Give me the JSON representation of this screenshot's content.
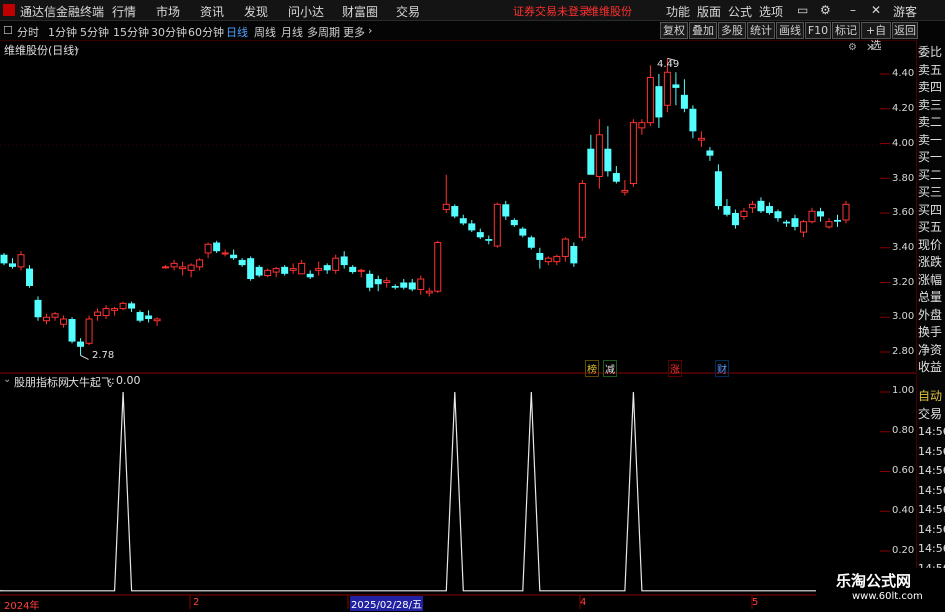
{
  "menubar": {
    "app_title": "通达信金融终端",
    "items": [
      "行情",
      "市场",
      "资讯",
      "发现",
      "问小达",
      "财富圈",
      "交易"
    ],
    "notice": "证券交易未登录",
    "stock": "维维股份",
    "right_items": [
      "功能",
      "版面",
      "公式",
      "选项"
    ],
    "guest": "游客"
  },
  "toolbar": {
    "periods": [
      "分时",
      "1分钟",
      "5分钟",
      "15分钟",
      "30分钟",
      "60分钟",
      "日线",
      "周线",
      "月线",
      "多周期",
      "更多"
    ],
    "selected": "日线",
    "buttons": [
      "复权",
      "叠加",
      "多股",
      "统计",
      "画线",
      "F10",
      "标记",
      "+自选",
      "返回"
    ]
  },
  "main_chart": {
    "title": "维维股份(日线)",
    "high_label": "4.49",
    "low_label": "2.78",
    "y_ticks": [
      "4.40",
      "4.20",
      "4.00",
      "3.80",
      "3.60",
      "3.40",
      "3.20",
      "3.00",
      "2.80"
    ],
    "event_tags": [
      {
        "text": "榜",
        "color": "#d8c030"
      },
      {
        "text": "减",
        "color": "#e0e0e0"
      },
      {
        "text": "涨",
        "color": "#ff3030"
      },
      {
        "text": "财",
        "color": "#5a9bff"
      }
    ]
  },
  "chart_data": {
    "type": "candlestick",
    "series": [
      {
        "name": "维维股份",
        "ohlc": [
          [
            3.36,
            3.37,
            3.3,
            3.31
          ],
          [
            3.31,
            3.34,
            3.28,
            3.29
          ],
          [
            3.29,
            3.38,
            3.27,
            3.36
          ],
          [
            3.28,
            3.3,
            3.17,
            3.18
          ],
          [
            3.1,
            3.12,
            2.98,
            3.0
          ],
          [
            2.98,
            3.02,
            2.96,
            3.0
          ],
          [
            3.0,
            3.03,
            2.98,
            3.02
          ],
          [
            2.96,
            3.01,
            2.94,
            2.99
          ],
          [
            2.99,
            3.0,
            2.85,
            2.86
          ],
          [
            2.86,
            2.88,
            2.78,
            2.83
          ],
          [
            2.85,
            3.01,
            2.84,
            2.99
          ],
          [
            3.01,
            3.05,
            2.98,
            3.03
          ],
          [
            3.01,
            3.07,
            2.99,
            3.05
          ],
          [
            3.04,
            3.06,
            3.01,
            3.05
          ],
          [
            3.05,
            3.09,
            3.04,
            3.08
          ],
          [
            3.08,
            3.09,
            3.03,
            3.05
          ],
          [
            3.03,
            3.04,
            2.97,
            2.98
          ],
          [
            3.01,
            3.04,
            2.97,
            2.99
          ],
          [
            2.98,
            3.0,
            2.95,
            2.99
          ],
          [
            3.29,
            3.3,
            3.28,
            3.29
          ],
          [
            3.29,
            3.33,
            3.27,
            3.31
          ],
          [
            3.28,
            3.32,
            3.24,
            3.29
          ],
          [
            3.27,
            3.31,
            3.23,
            3.3
          ],
          [
            3.29,
            3.34,
            3.27,
            3.33
          ],
          [
            3.37,
            3.43,
            3.34,
            3.42
          ],
          [
            3.43,
            3.44,
            3.37,
            3.38
          ],
          [
            3.37,
            3.39,
            3.35,
            3.37
          ],
          [
            3.36,
            3.39,
            3.33,
            3.34
          ],
          [
            3.33,
            3.34,
            3.29,
            3.3
          ],
          [
            3.34,
            3.35,
            3.21,
            3.22
          ],
          [
            3.29,
            3.3,
            3.23,
            3.24
          ],
          [
            3.24,
            3.28,
            3.23,
            3.27
          ],
          [
            3.26,
            3.29,
            3.23,
            3.28
          ],
          [
            3.29,
            3.3,
            3.24,
            3.25
          ],
          [
            3.27,
            3.31,
            3.25,
            3.28
          ],
          [
            3.25,
            3.33,
            3.25,
            3.31
          ],
          [
            3.25,
            3.27,
            3.22,
            3.23
          ],
          [
            3.27,
            3.32,
            3.24,
            3.28
          ],
          [
            3.3,
            3.31,
            3.25,
            3.27
          ],
          [
            3.27,
            3.36,
            3.25,
            3.34
          ],
          [
            3.35,
            3.38,
            3.28,
            3.3
          ],
          [
            3.29,
            3.3,
            3.25,
            3.26
          ],
          [
            3.27,
            3.28,
            3.23,
            3.27
          ],
          [
            3.25,
            3.27,
            3.15,
            3.17
          ],
          [
            3.22,
            3.24,
            3.15,
            3.19
          ],
          [
            3.2,
            3.23,
            3.17,
            3.21
          ],
          [
            3.18,
            3.19,
            3.16,
            3.17
          ],
          [
            3.2,
            3.22,
            3.16,
            3.17
          ],
          [
            3.2,
            3.22,
            3.15,
            3.16
          ],
          [
            3.16,
            3.24,
            3.13,
            3.22
          ],
          [
            3.14,
            3.17,
            3.12,
            3.15
          ],
          [
            3.15,
            3.44,
            3.14,
            3.43
          ],
          [
            3.62,
            3.82,
            3.6,
            3.65
          ],
          [
            3.64,
            3.65,
            3.57,
            3.58
          ],
          [
            3.57,
            3.59,
            3.53,
            3.54
          ],
          [
            3.54,
            3.56,
            3.49,
            3.5
          ],
          [
            3.49,
            3.51,
            3.45,
            3.46
          ],
          [
            3.45,
            3.47,
            3.42,
            3.44
          ],
          [
            3.41,
            3.66,
            3.4,
            3.65
          ],
          [
            3.65,
            3.67,
            3.56,
            3.58
          ],
          [
            3.56,
            3.57,
            3.52,
            3.53
          ],
          [
            3.51,
            3.52,
            3.46,
            3.47
          ],
          [
            3.46,
            3.47,
            3.39,
            3.4
          ],
          [
            3.37,
            3.4,
            3.28,
            3.33
          ],
          [
            3.32,
            3.35,
            3.3,
            3.34
          ],
          [
            3.32,
            3.36,
            3.3,
            3.35
          ],
          [
            3.35,
            3.46,
            3.32,
            3.45
          ],
          [
            3.41,
            3.43,
            3.29,
            3.31
          ],
          [
            3.46,
            3.79,
            3.44,
            3.77
          ],
          [
            3.97,
            4.05,
            3.88,
            3.82
          ],
          [
            3.81,
            4.14,
            3.74,
            4.05
          ],
          [
            3.97,
            4.1,
            3.81,
            3.84
          ],
          [
            3.83,
            3.87,
            3.77,
            3.78
          ],
          [
            3.72,
            3.79,
            3.7,
            3.73
          ],
          [
            3.77,
            4.14,
            3.75,
            4.12
          ],
          [
            4.09,
            4.14,
            4.05,
            4.12
          ],
          [
            4.12,
            4.45,
            4.1,
            4.38
          ],
          [
            4.33,
            4.4,
            4.09,
            4.15
          ],
          [
            4.22,
            4.49,
            4.18,
            4.41
          ],
          [
            4.34,
            4.41,
            4.22,
            4.32
          ],
          [
            4.28,
            4.37,
            4.18,
            4.2
          ],
          [
            4.2,
            4.22,
            4.03,
            4.07
          ],
          [
            4.02,
            4.07,
            3.98,
            4.03
          ],
          [
            3.96,
            3.98,
            3.9,
            3.93
          ],
          [
            3.84,
            3.88,
            3.62,
            3.64
          ],
          [
            3.64,
            3.68,
            3.58,
            3.59
          ],
          [
            3.6,
            3.62,
            3.51,
            3.53
          ],
          [
            3.58,
            3.63,
            3.56,
            3.61
          ],
          [
            3.63,
            3.67,
            3.6,
            3.65
          ],
          [
            3.67,
            3.69,
            3.6,
            3.61
          ],
          [
            3.64,
            3.66,
            3.59,
            3.6
          ],
          [
            3.61,
            3.62,
            3.55,
            3.57
          ],
          [
            3.55,
            3.56,
            3.52,
            3.54
          ],
          [
            3.57,
            3.59,
            3.5,
            3.52
          ],
          [
            3.49,
            3.56,
            3.46,
            3.55
          ],
          [
            3.55,
            3.63,
            3.54,
            3.61
          ],
          [
            3.61,
            3.63,
            3.55,
            3.58
          ],
          [
            3.52,
            3.57,
            3.51,
            3.55
          ],
          [
            3.56,
            3.59,
            3.52,
            3.55
          ],
          [
            3.56,
            3.67,
            3.54,
            3.65
          ]
        ]
      }
    ],
    "ylim": [
      2.7,
      4.58
    ],
    "x_labels": [
      "2024年",
      "2",
      "2025/02/28/五",
      "4",
      "5"
    ]
  },
  "indicator": {
    "title": "股朋指标网",
    "signal_name": "大牛起飞",
    "signal_value": "0.00",
    "y_ticks": [
      "1.00",
      "0.80",
      "0.60",
      "0.40",
      "0.20"
    ],
    "spike_bars": [
      14,
      53,
      62,
      74
    ]
  },
  "side_tabs": [
    "委比",
    "卖五",
    "卖四",
    "卖三",
    "卖二",
    "卖一",
    "买一",
    "买二",
    "买三",
    "买四",
    "买五",
    "现价",
    "涨跌",
    "涨幅",
    "总量",
    "外盘",
    "换手",
    "净资",
    "收益"
  ],
  "side_lower": {
    "auto": "自动",
    "trade": "交易",
    "times": [
      "14:56",
      "14:56",
      "14:56",
      "14:56",
      "14:56",
      "14:56",
      "14:56",
      "14:56",
      "14:56"
    ]
  },
  "watermark": {
    "line1": "乐淘公式网",
    "line2": "www.60lt.com"
  },
  "colors": {
    "up": "#ff3232",
    "down": "#54ffff",
    "accent": "#ff3030",
    "selected": "#4fa0ff"
  }
}
